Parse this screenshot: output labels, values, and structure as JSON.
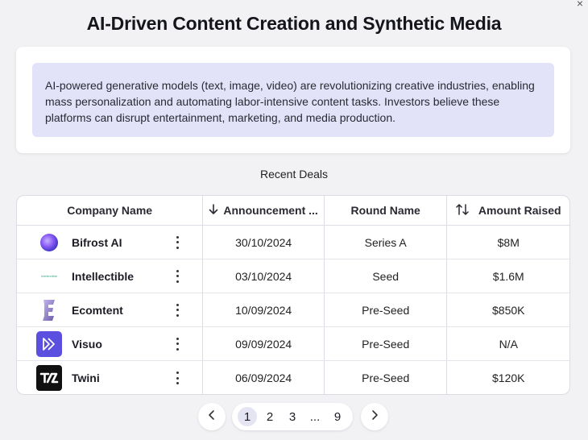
{
  "page": {
    "title": "AI-Driven Content Creation and Synthetic Media",
    "summary": "AI-powered generative models (text, image, video) are revolutionizing creative industries, enabling mass personalization and automating labor-intensive content tasks. Investors believe these platforms can disrupt entertainment, marketing, and media production.",
    "section_label": "Recent Deals",
    "close_icon": "×"
  },
  "table": {
    "headers": {
      "company": "Company Name",
      "date": "Announcement ...",
      "round": "Round Name",
      "amount": "Amount Raised"
    },
    "header_icons": {
      "date": "arrow-down-icon",
      "amount": "sort-up-down-icon"
    },
    "rows": [
      {
        "company": "Bifrost AI",
        "logo": "bifrost-logo",
        "date": "30/10/2024",
        "round": "Series A",
        "amount": "$8M"
      },
      {
        "company": "Intellectible",
        "logo": "intellectible-logo",
        "logo_text": "Intellectible",
        "date": "03/10/2024",
        "round": "Seed",
        "amount": "$1.6M"
      },
      {
        "company": "Ecomtent",
        "logo": "ecomtent-logo",
        "date": "10/09/2024",
        "round": "Pre-Seed",
        "amount": "$850K"
      },
      {
        "company": "Visuo",
        "logo": "visuo-logo",
        "date": "09/09/2024",
        "round": "Pre-Seed",
        "amount": "N/A"
      },
      {
        "company": "Twini",
        "logo": "twini-logo",
        "date": "06/09/2024",
        "round": "Pre-Seed",
        "amount": "$120K"
      }
    ]
  },
  "pagination": {
    "pages": [
      "1",
      "2",
      "3",
      "...",
      "9"
    ],
    "active": "1"
  },
  "colors": {
    "background": "#f2f2f5",
    "summary_box": "#e2e2f9",
    "active_page": "#e4e4f3",
    "visuo_brand": "#5b4fe0",
    "bifrost_brand": "#8b5cf6"
  }
}
